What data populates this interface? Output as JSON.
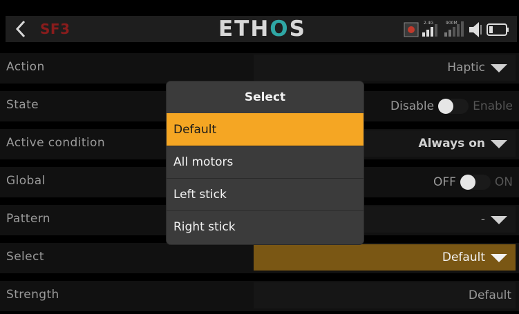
{
  "header": {
    "title": "SF3",
    "logo_prefix": "ETH",
    "logo_accent": "O",
    "logo_suffix": "S",
    "signal_24g": "2.4G",
    "signal_900m": "900M"
  },
  "rows": [
    {
      "label": "Action",
      "value": "Haptic"
    },
    {
      "label": "State",
      "toggle_off": "Disable",
      "toggle_on": "Enable"
    },
    {
      "label": "Active condition",
      "value": "Always on"
    },
    {
      "label": "Global",
      "toggle_off": "OFF",
      "toggle_on": "ON"
    },
    {
      "label": "Pattern",
      "value": "-"
    },
    {
      "label": "Select",
      "value": "Default"
    },
    {
      "label": "Strength",
      "value": "Default"
    }
  ],
  "popup": {
    "title": "Select",
    "options": [
      "Default",
      "All motors",
      "Left stick",
      "Right stick"
    ],
    "selected": "Default"
  },
  "colors": {
    "accent": "#f5a623",
    "title_red": "#8a1c1c",
    "logo_teal": "#2fa7a5"
  }
}
